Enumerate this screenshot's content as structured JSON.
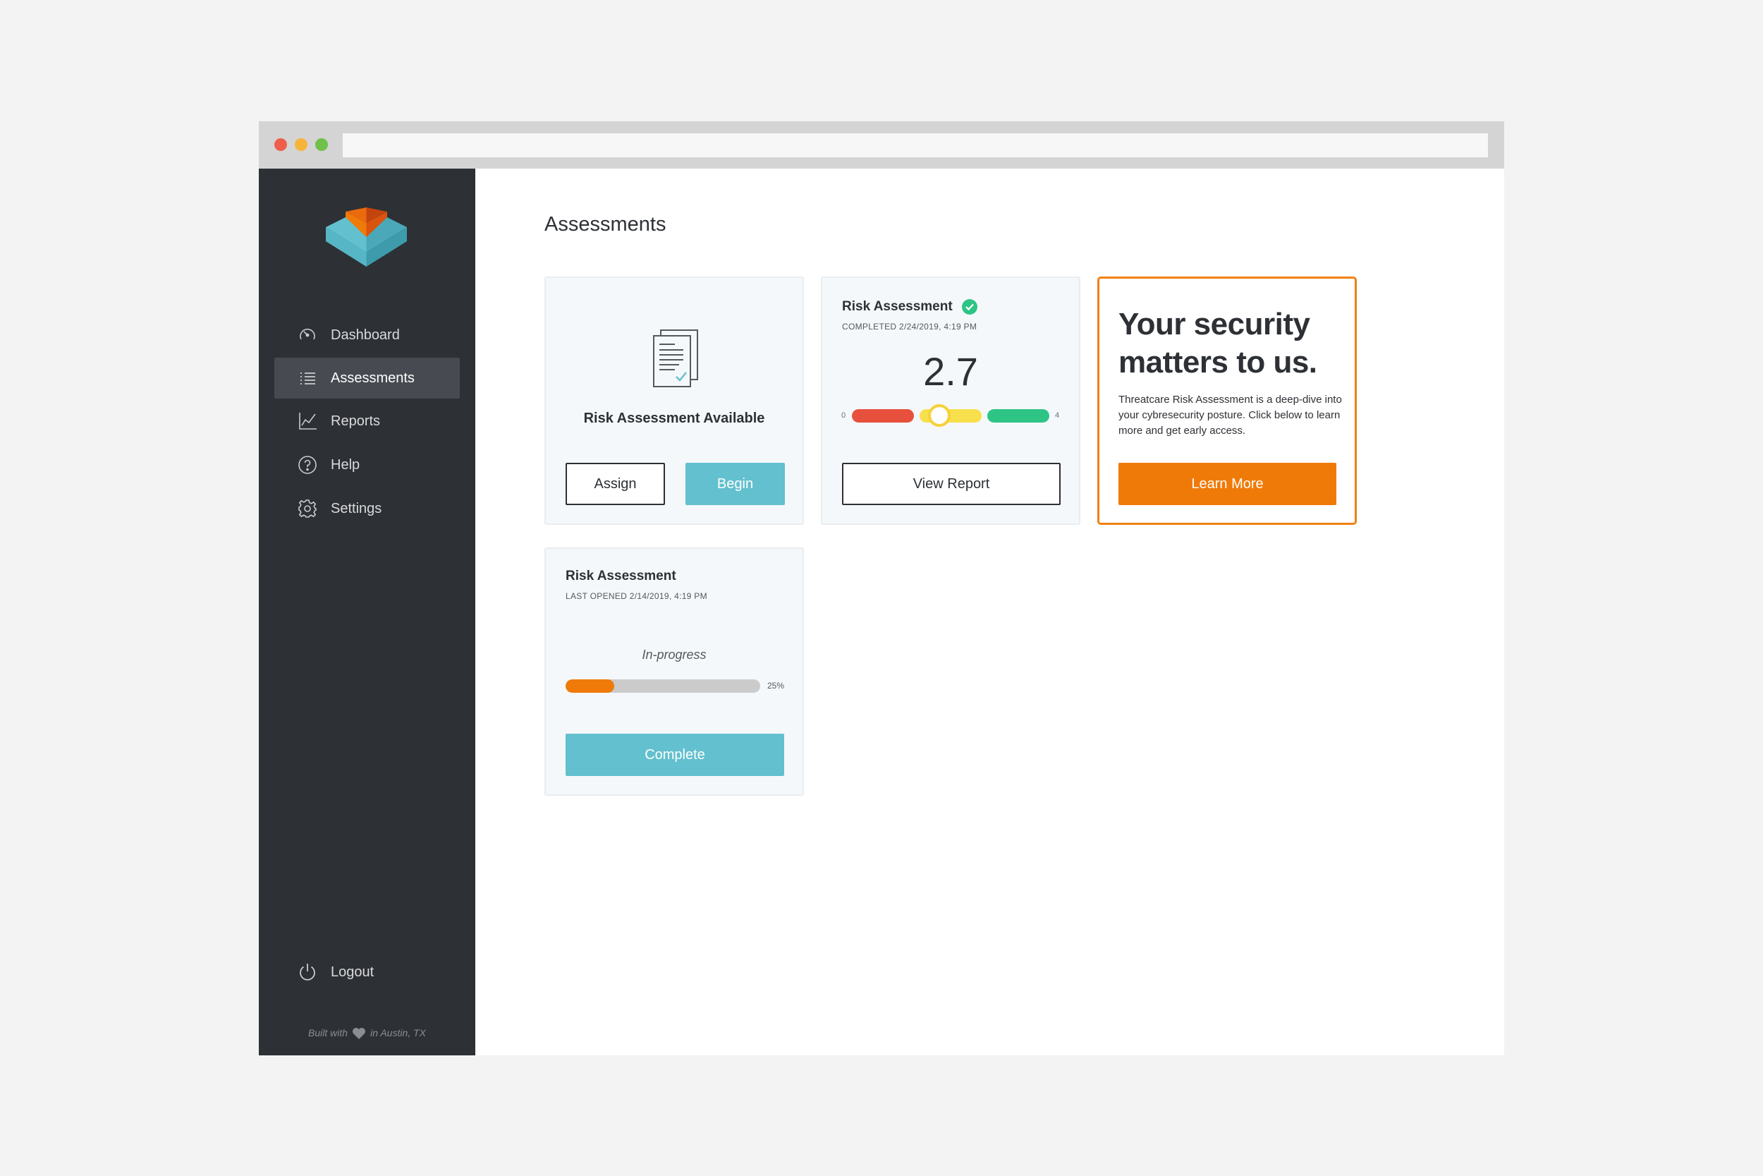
{
  "colors": {
    "sidebar_bg": "#2d3035",
    "sidebar_active": "#474b51",
    "accent_teal": "#63c0ce",
    "accent_orange": "#f07a08",
    "gauge_red": "#e8503e",
    "gauge_yellow": "#f7e04b",
    "gauge_green": "#2ec486",
    "success_green": "#2ec486"
  },
  "sidebar": {
    "items": [
      {
        "label": "Dashboard",
        "icon": "dashboard-gauge-icon",
        "active": false
      },
      {
        "label": "Assessments",
        "icon": "list-icon",
        "active": true
      },
      {
        "label": "Reports",
        "icon": "line-chart-icon",
        "active": false
      },
      {
        "label": "Help",
        "icon": "question-circle-icon",
        "active": false
      },
      {
        "label": "Settings",
        "icon": "gear-icon",
        "active": false
      }
    ],
    "logout": {
      "label": "Logout",
      "icon": "power-icon"
    },
    "footer": {
      "before": "Built with",
      "after": "in Austin, TX",
      "icon": "heart-icon"
    }
  },
  "main": {
    "title": "Assessments",
    "available_card": {
      "icon": "document-check-icon",
      "title": "Risk Assessment Available",
      "assign_label": "Assign",
      "begin_label": "Begin"
    },
    "completed_card": {
      "title": "Risk Assessment",
      "status_icon": "check-circle-icon",
      "subtitle": "COMPLETED 2/24/2019, 4:19 PM",
      "score": "2.7",
      "score_value": 2.7,
      "scale_min": "0",
      "scale_max": "4",
      "view_label": "View Report"
    },
    "promo_card": {
      "headline": "Your security matters to us.",
      "body": "Threatcare Risk Assessment is a deep-dive into your cybresecurity posture. Click below to learn more and get early access.",
      "button_label": "Learn More"
    },
    "progress_card": {
      "title": "Risk Assessment",
      "subtitle": "LAST OPENED 2/14/2019, 4:19 PM",
      "status": "In-progress",
      "progress_value": 0.25,
      "progress_label": "25%",
      "button_label": "Complete"
    }
  }
}
